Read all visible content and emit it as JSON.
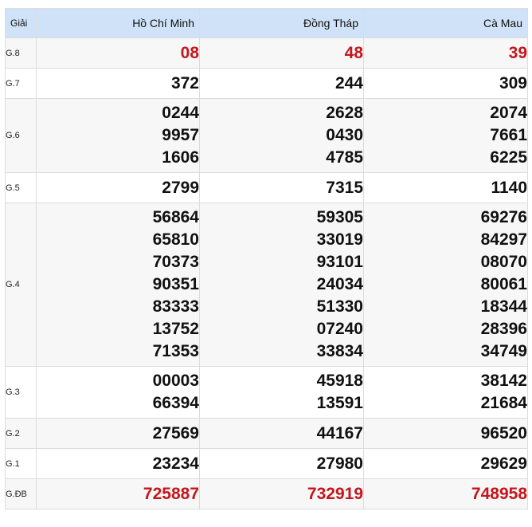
{
  "header": {
    "prize_col": "Giải",
    "provinces": [
      "Hồ Chí Minh",
      "Đồng Tháp",
      "Cà Mau"
    ]
  },
  "colors": {
    "header_bg": "#cfe2f8",
    "highlight_red": "#c4161c",
    "zebra_bg": "#f7f7f7"
  },
  "rows": [
    {
      "label": "G.8",
      "values": [
        [
          "08"
        ],
        [
          "48"
        ],
        [
          "39"
        ]
      ]
    },
    {
      "label": "G.7",
      "values": [
        [
          "372"
        ],
        [
          "244"
        ],
        [
          "309"
        ]
      ]
    },
    {
      "label": "G.6",
      "values": [
        [
          "0244",
          "9957",
          "1606"
        ],
        [
          "2628",
          "0430",
          "4785"
        ],
        [
          "2074",
          "7661",
          "6225"
        ]
      ]
    },
    {
      "label": "G.5",
      "values": [
        [
          "2799"
        ],
        [
          "7315"
        ],
        [
          "1140"
        ]
      ]
    },
    {
      "label": "G.4",
      "values": [
        [
          "56864",
          "65810",
          "70373",
          "90351",
          "83333",
          "13752",
          "71353"
        ],
        [
          "59305",
          "33019",
          "93101",
          "24034",
          "51330",
          "07240",
          "33834"
        ],
        [
          "69276",
          "84297",
          "08070",
          "80061",
          "18344",
          "28396",
          "34749"
        ]
      ]
    },
    {
      "label": "G.3",
      "values": [
        [
          "00003",
          "66394"
        ],
        [
          "45918",
          "13591"
        ],
        [
          "38142",
          "21684"
        ]
      ]
    },
    {
      "label": "G.2",
      "values": [
        [
          "27569"
        ],
        [
          "44167"
        ],
        [
          "96520"
        ]
      ]
    },
    {
      "label": "G.1",
      "values": [
        [
          "23234"
        ],
        [
          "27980"
        ],
        [
          "29629"
        ]
      ]
    },
    {
      "label": "G.ĐB",
      "values": [
        [
          "725887"
        ],
        [
          "732919"
        ],
        [
          "748958"
        ]
      ]
    }
  ]
}
